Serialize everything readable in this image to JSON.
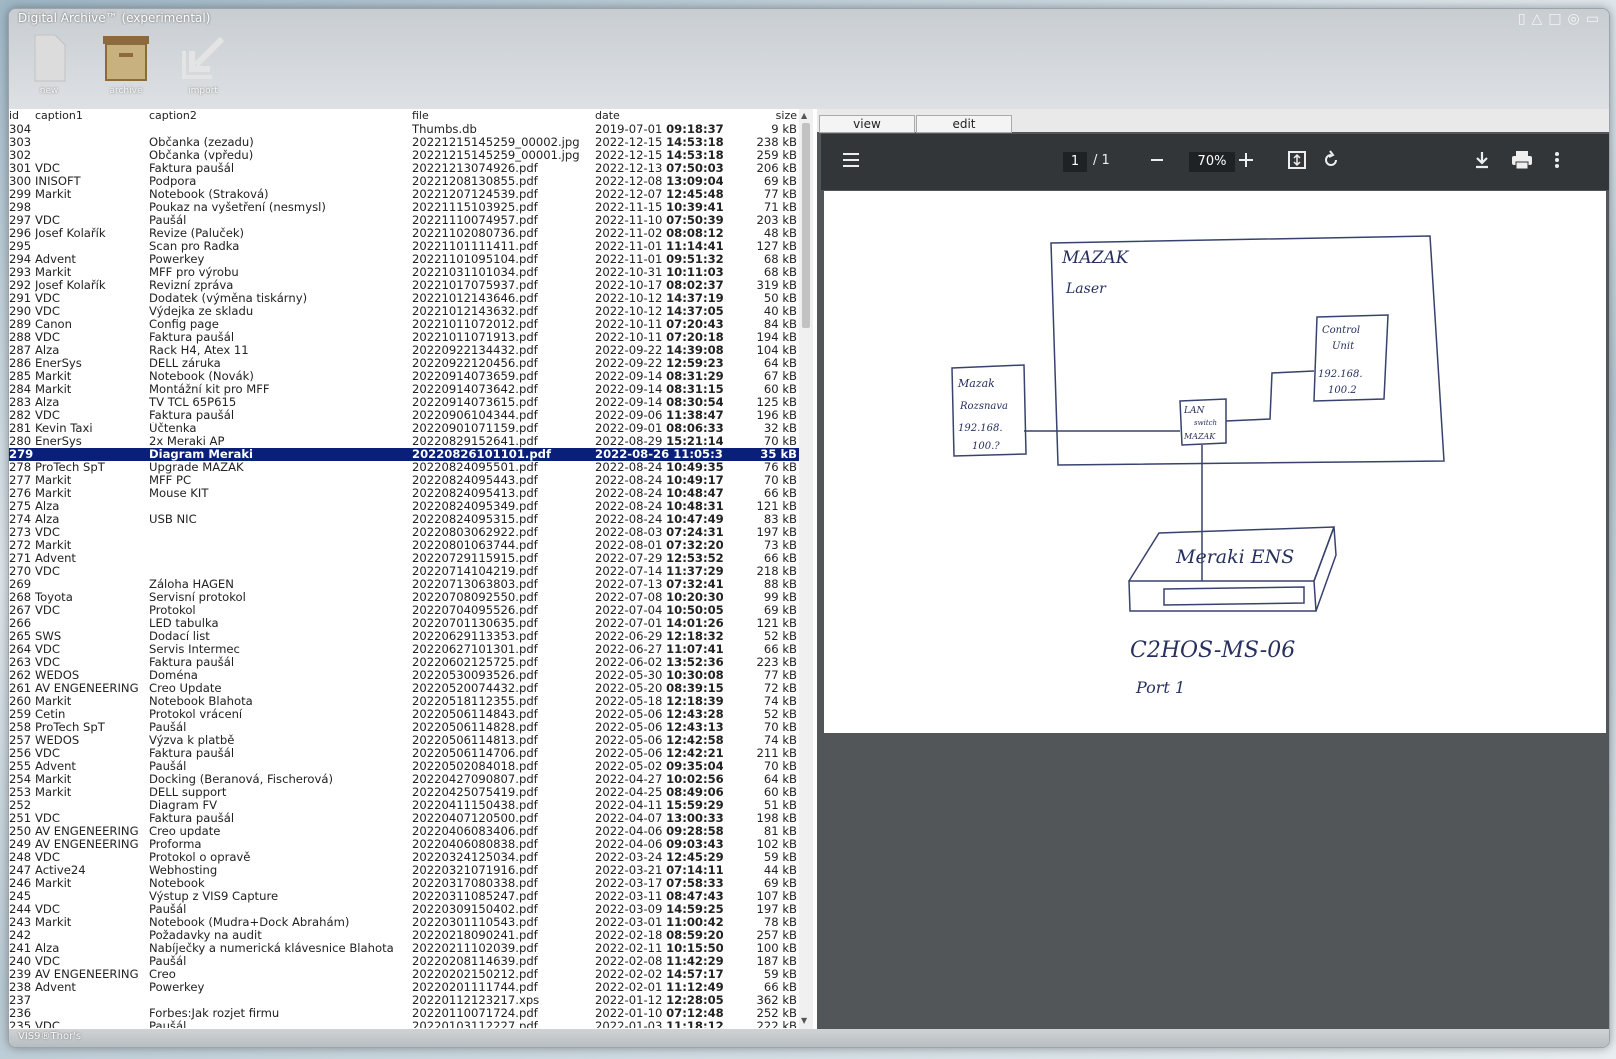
{
  "window": {
    "title": "Digital Archive™ (experimental)",
    "footer": "VIS9®Thor's"
  },
  "toolbar": {
    "new_label": "new",
    "archive_label": "archive",
    "import_label": "import"
  },
  "list": {
    "columns": {
      "id": "id",
      "caption1": "caption1",
      "caption2": "caption2",
      "file": "file",
      "date": "date",
      "size": "size"
    },
    "rows": [
      {
        "id": "304",
        "c1": "",
        "c2": "",
        "file": "Thumbs.db",
        "date": "2019-07-01",
        "time": "09:18:37",
        "size": "9 kB"
      },
      {
        "id": "303",
        "c1": "",
        "c2": "Občanka (zezadu)",
        "file": "20221215145259_00002.jpg",
        "date": "2022-12-15",
        "time": "14:53:18",
        "size": "238 kB"
      },
      {
        "id": "302",
        "c1": "",
        "c2": "Občanka (vpředu)",
        "file": "20221215145259_00001.jpg",
        "date": "2022-12-15",
        "time": "14:53:18",
        "size": "259 kB"
      },
      {
        "id": "301",
        "c1": "VDC",
        "c2": "Faktura paušál",
        "file": "20221213074926.pdf",
        "date": "2022-12-13",
        "time": "07:50:03",
        "size": "206 kB"
      },
      {
        "id": "300",
        "c1": "INISOFT",
        "c2": "Podpora",
        "file": "20221208130855.pdf",
        "date": "2022-12-08",
        "time": "13:09:04",
        "size": "69 kB"
      },
      {
        "id": "299",
        "c1": "Markit",
        "c2": "Notebook (Straková)",
        "file": "20221207124539.pdf",
        "date": "2022-12-07",
        "time": "12:45:48",
        "size": "77 kB"
      },
      {
        "id": "298",
        "c1": "",
        "c2": "Poukaz na vyšetření (nesmysl)",
        "file": "20221115103925.pdf",
        "date": "2022-11-15",
        "time": "10:39:41",
        "size": "71 kB"
      },
      {
        "id": "297",
        "c1": "VDC",
        "c2": "Paušál",
        "file": "20221110074957.pdf",
        "date": "2022-11-10",
        "time": "07:50:39",
        "size": "203 kB"
      },
      {
        "id": "296",
        "c1": "Josef Kolařík",
        "c2": "Revize (Paluček)",
        "file": "20221102080736.pdf",
        "date": "2022-11-02",
        "time": "08:08:12",
        "size": "48 kB"
      },
      {
        "id": "295",
        "c1": "",
        "c2": "Scan pro Radka",
        "file": "20221101111411.pdf",
        "date": "2022-11-01",
        "time": "11:14:41",
        "size": "127 kB"
      },
      {
        "id": "294",
        "c1": "Advent",
        "c2": "Powerkey",
        "file": "20221101095104.pdf",
        "date": "2022-11-01",
        "time": "09:51:32",
        "size": "68 kB"
      },
      {
        "id": "293",
        "c1": "Markit",
        "c2": "MFF pro výrobu",
        "file": "20221031101034.pdf",
        "date": "2022-10-31",
        "time": "10:11:03",
        "size": "68 kB"
      },
      {
        "id": "292",
        "c1": "Josef Kolařík",
        "c2": "Revizní zpráva",
        "file": "20221017075937.pdf",
        "date": "2022-10-17",
        "time": "08:02:37",
        "size": "319 kB"
      },
      {
        "id": "291",
        "c1": "VDC",
        "c2": "Dodatek (výměna tiskárny)",
        "file": "20221012143646.pdf",
        "date": "2022-10-12",
        "time": "14:37:19",
        "size": "50 kB"
      },
      {
        "id": "290",
        "c1": "VDC",
        "c2": "Výdejka ze skladu",
        "file": "20221012143632.pdf",
        "date": "2022-10-12",
        "time": "14:37:05",
        "size": "40 kB"
      },
      {
        "id": "289",
        "c1": "Canon",
        "c2": "Config page",
        "file": "20221011072012.pdf",
        "date": "2022-10-11",
        "time": "07:20:43",
        "size": "84 kB"
      },
      {
        "id": "288",
        "c1": "VDC",
        "c2": "Faktura paušál",
        "file": "20221011071913.pdf",
        "date": "2022-10-11",
        "time": "07:20:18",
        "size": "194 kB"
      },
      {
        "id": "287",
        "c1": "Alza",
        "c2": "Rack H4, Atex 11",
        "file": "20220922134432.pdf",
        "date": "2022-09-22",
        "time": "14:39:08",
        "size": "104 kB"
      },
      {
        "id": "286",
        "c1": "EnerSys",
        "c2": "DELL záruka",
        "file": "20220922120456.pdf",
        "date": "2022-09-22",
        "time": "12:59:23",
        "size": "64 kB"
      },
      {
        "id": "285",
        "c1": "Markit",
        "c2": "Notebook (Novák)",
        "file": "20220914073659.pdf",
        "date": "2022-09-14",
        "time": "08:31:29",
        "size": "67 kB"
      },
      {
        "id": "284",
        "c1": "Markit",
        "c2": "Montážní kit pro MFF",
        "file": "20220914073642.pdf",
        "date": "2022-09-14",
        "time": "08:31:15",
        "size": "60 kB"
      },
      {
        "id": "283",
        "c1": "Alza",
        "c2": "TV TCL 65P615",
        "file": "20220914073615.pdf",
        "date": "2022-09-14",
        "time": "08:30:54",
        "size": "125 kB"
      },
      {
        "id": "282",
        "c1": "VDC",
        "c2": "Faktura paušál",
        "file": "20220906104344.pdf",
        "date": "2022-09-06",
        "time": "11:38:47",
        "size": "196 kB"
      },
      {
        "id": "281",
        "c1": "Kevin Taxi",
        "c2": "Účtenka",
        "file": "20220901071159.pdf",
        "date": "2022-09-01",
        "time": "08:06:33",
        "size": "32 kB"
      },
      {
        "id": "280",
        "c1": "EnerSys",
        "c2": "2x Meraki AP",
        "file": "20220829152641.pdf",
        "date": "2022-08-29",
        "time": "15:21:14",
        "size": "70 kB"
      },
      {
        "id": "279",
        "c1": "",
        "c2": "Diagram Meraki",
        "file": "20220826101101.pdf",
        "date": "2022-08-26",
        "time": "11:05:35",
        "size": "35 kB",
        "selected": true
      },
      {
        "id": "278",
        "c1": "ProTech SpT",
        "c2": "Upgrade MAZAK",
        "file": "20220824095501.pdf",
        "date": "2022-08-24",
        "time": "10:49:35",
        "size": "76 kB"
      },
      {
        "id": "277",
        "c1": "Markit",
        "c2": "MFF PC",
        "file": "20220824095443.pdf",
        "date": "2022-08-24",
        "time": "10:49:17",
        "size": "70 kB"
      },
      {
        "id": "276",
        "c1": "Markit",
        "c2": "Mouse KIT",
        "file": "20220824095413.pdf",
        "date": "2022-08-24",
        "time": "10:48:47",
        "size": "66 kB"
      },
      {
        "id": "275",
        "c1": "Alza",
        "c2": "",
        "file": "20220824095349.pdf",
        "date": "2022-08-24",
        "time": "10:48:31",
        "size": "121 kB"
      },
      {
        "id": "274",
        "c1": "Alza",
        "c2": "USB NIC",
        "file": "20220824095315.pdf",
        "date": "2022-08-24",
        "time": "10:47:49",
        "size": "83 kB"
      },
      {
        "id": "273",
        "c1": "VDC",
        "c2": "",
        "file": "20220803062922.pdf",
        "date": "2022-08-03",
        "time": "07:24:31",
        "size": "197 kB"
      },
      {
        "id": "272",
        "c1": "Markit",
        "c2": "",
        "file": "20220801063744.pdf",
        "date": "2022-08-01",
        "time": "07:32:20",
        "size": "73 kB"
      },
      {
        "id": "271",
        "c1": "Advent",
        "c2": "",
        "file": "20220729115915.pdf",
        "date": "2022-07-29",
        "time": "12:53:52",
        "size": "66 kB"
      },
      {
        "id": "270",
        "c1": "VDC",
        "c2": "",
        "file": "20220714104219.pdf",
        "date": "2022-07-14",
        "time": "11:37:29",
        "size": "218 kB"
      },
      {
        "id": "269",
        "c1": "",
        "c2": "Záloha HAGEN",
        "file": "20220713063803.pdf",
        "date": "2022-07-13",
        "time": "07:32:41",
        "size": "88 kB"
      },
      {
        "id": "268",
        "c1": "Toyota",
        "c2": "Servisní protokol",
        "file": "20220708092550.pdf",
        "date": "2022-07-08",
        "time": "10:20:30",
        "size": "99 kB"
      },
      {
        "id": "267",
        "c1": "VDC",
        "c2": "Protokol",
        "file": "20220704095526.pdf",
        "date": "2022-07-04",
        "time": "10:50:05",
        "size": "69 kB"
      },
      {
        "id": "266",
        "c1": "",
        "c2": "LED tabulka",
        "file": "20220701130635.pdf",
        "date": "2022-07-01",
        "time": "14:01:26",
        "size": "121 kB"
      },
      {
        "id": "265",
        "c1": "SWS",
        "c2": "Dodací list",
        "file": "20220629113353.pdf",
        "date": "2022-06-29",
        "time": "12:18:32",
        "size": "52 kB"
      },
      {
        "id": "264",
        "c1": "VDC",
        "c2": "Servis Intermec",
        "file": "20220627101301.pdf",
        "date": "2022-06-27",
        "time": "11:07:41",
        "size": "66 kB"
      },
      {
        "id": "263",
        "c1": "VDC",
        "c2": "Faktura paušál",
        "file": "20220602125725.pdf",
        "date": "2022-06-02",
        "time": "13:52:36",
        "size": "223 kB"
      },
      {
        "id": "262",
        "c1": "WEDOS",
        "c2": "Doména",
        "file": "20220530093526.pdf",
        "date": "2022-05-30",
        "time": "10:30:08",
        "size": "77 kB"
      },
      {
        "id": "261",
        "c1": "AV ENGENEERING",
        "c2": "Creo Update",
        "file": "20220520074432.pdf",
        "date": "2022-05-20",
        "time": "08:39:15",
        "size": "72 kB"
      },
      {
        "id": "260",
        "c1": "Markit",
        "c2": "Notebook Blahota",
        "file": "20220518112355.pdf",
        "date": "2022-05-18",
        "time": "12:18:39",
        "size": "74 kB"
      },
      {
        "id": "259",
        "c1": "Cetin",
        "c2": "Protokol vrácení",
        "file": "20220506114843.pdf",
        "date": "2022-05-06",
        "time": "12:43:28",
        "size": "52 kB"
      },
      {
        "id": "258",
        "c1": "ProTech SpT",
        "c2": "Paušál",
        "file": "20220506114828.pdf",
        "date": "2022-05-06",
        "time": "12:43:13",
        "size": "70 kB"
      },
      {
        "id": "257",
        "c1": "WEDOS",
        "c2": "Výzva k platbě",
        "file": "20220506114813.pdf",
        "date": "2022-05-06",
        "time": "12:42:58",
        "size": "74 kB"
      },
      {
        "id": "256",
        "c1": "VDC",
        "c2": "Faktura paušál",
        "file": "20220506114706.pdf",
        "date": "2022-05-06",
        "time": "12:42:21",
        "size": "211 kB"
      },
      {
        "id": "255",
        "c1": "Advent",
        "c2": "Paušál",
        "file": "20220502084018.pdf",
        "date": "2022-05-02",
        "time": "09:35:04",
        "size": "70 kB"
      },
      {
        "id": "254",
        "c1": "Markit",
        "c2": "Docking (Beranová, Fischerová)",
        "file": "20220427090807.pdf",
        "date": "2022-04-27",
        "time": "10:02:56",
        "size": "64 kB"
      },
      {
        "id": "253",
        "c1": "Markit",
        "c2": "DELL support",
        "file": "20220425075419.pdf",
        "date": "2022-04-25",
        "time": "08:49:06",
        "size": "60 kB"
      },
      {
        "id": "252",
        "c1": "",
        "c2": "Diagram FV",
        "file": "20220411150438.pdf",
        "date": "2022-04-11",
        "time": "15:59:29",
        "size": "51 kB"
      },
      {
        "id": "251",
        "c1": "VDC",
        "c2": "Faktura paušál",
        "file": "20220407120500.pdf",
        "date": "2022-04-07",
        "time": "13:00:33",
        "size": "198 kB"
      },
      {
        "id": "250",
        "c1": "AV ENGENEERING",
        "c2": "Creo update",
        "file": "20220406083406.pdf",
        "date": "2022-04-06",
        "time": "09:28:58",
        "size": "81 kB"
      },
      {
        "id": "249",
        "c1": "AV ENGENEERING",
        "c2": "Proforma",
        "file": "20220406080838.pdf",
        "date": "2022-04-06",
        "time": "09:03:43",
        "size": "102 kB"
      },
      {
        "id": "248",
        "c1": "VDC",
        "c2": "Protokol o opravě",
        "file": "20220324125034.pdf",
        "date": "2022-03-24",
        "time": "12:45:29",
        "size": "59 kB"
      },
      {
        "id": "247",
        "c1": "Active24",
        "c2": "Webhosting",
        "file": "20220321071916.pdf",
        "date": "2022-03-21",
        "time": "07:14:11",
        "size": "44 kB"
      },
      {
        "id": "246",
        "c1": "Markit",
        "c2": "Notebook",
        "file": "20220317080338.pdf",
        "date": "2022-03-17",
        "time": "07:58:33",
        "size": "69 kB"
      },
      {
        "id": "245",
        "c1": "",
        "c2": "Výstup z VIS9 Capture",
        "file": "20220311085247.pdf",
        "date": "2022-03-11",
        "time": "08:47:43",
        "size": "107 kB"
      },
      {
        "id": "244",
        "c1": "VDC",
        "c2": "Paušál",
        "file": "20220309150402.pdf",
        "date": "2022-03-09",
        "time": "14:59:25",
        "size": "197 kB"
      },
      {
        "id": "243",
        "c1": "Markit",
        "c2": "Notebook (Mudra+Dock Abrahám)",
        "file": "20220301110543.pdf",
        "date": "2022-03-01",
        "time": "11:00:42",
        "size": "78 kB"
      },
      {
        "id": "242",
        "c1": "",
        "c2": "Požadavky na audit",
        "file": "20220218090241.pdf",
        "date": "2022-02-18",
        "time": "08:59:20",
        "size": "257 kB"
      },
      {
        "id": "241",
        "c1": "Alza",
        "c2": "Nabíječky a numerická klávesnice Blahota",
        "file": "20220211102039.pdf",
        "date": "2022-02-11",
        "time": "10:15:50",
        "size": "100 kB"
      },
      {
        "id": "240",
        "c1": "VDC",
        "c2": "Paušál",
        "file": "20220208114639.pdf",
        "date": "2022-02-08",
        "time": "11:42:29",
        "size": "187 kB"
      },
      {
        "id": "239",
        "c1": "AV ENGENEERING",
        "c2": "Creo",
        "file": "20220202150212.pdf",
        "date": "2022-02-02",
        "time": "14:57:17",
        "size": "59 kB"
      },
      {
        "id": "238",
        "c1": "Advent",
        "c2": "Powerkey",
        "file": "20220201111744.pdf",
        "date": "2022-02-01",
        "time": "11:12:49",
        "size": "66 kB"
      },
      {
        "id": "237",
        "c1": "",
        "c2": "",
        "file": "20220112123217.xps",
        "date": "2022-01-12",
        "time": "12:28:05",
        "size": "362 kB"
      },
      {
        "id": "236",
        "c1": "",
        "c2": "Forbes:Jak rozjet firmu",
        "file": "20220110071724.pdf",
        "date": "2022-01-10",
        "time": "07:12:48",
        "size": "252 kB"
      },
      {
        "id": "235",
        "c1": "VDC",
        "c2": "Paušál",
        "file": "20220103112227.pdf",
        "date": "2022-01-03",
        "time": "11:18:12",
        "size": "222 kB"
      }
    ]
  },
  "viewer": {
    "tabs": [
      {
        "label": "view"
      },
      {
        "label": "edit"
      }
    ],
    "page_current": "1",
    "page_of": "/ 1",
    "zoom": "70%",
    "drawing": {
      "machine_label": "MAZAK",
      "machine_sublabel": "Laser",
      "control_unit_lines": [
        "Control",
        "Unit",
        "192.168.",
        "100.2"
      ],
      "mazak_left_lines": [
        "Mazak",
        "Rozsnava",
        "192.168.",
        "100.?"
      ],
      "switch_lines": [
        "LAN",
        "switch",
        "MAZAK"
      ],
      "meraki_label": "Meraki ENS",
      "device_id": "C2HOS-MS-06",
      "port_label": "Port 1"
    }
  }
}
